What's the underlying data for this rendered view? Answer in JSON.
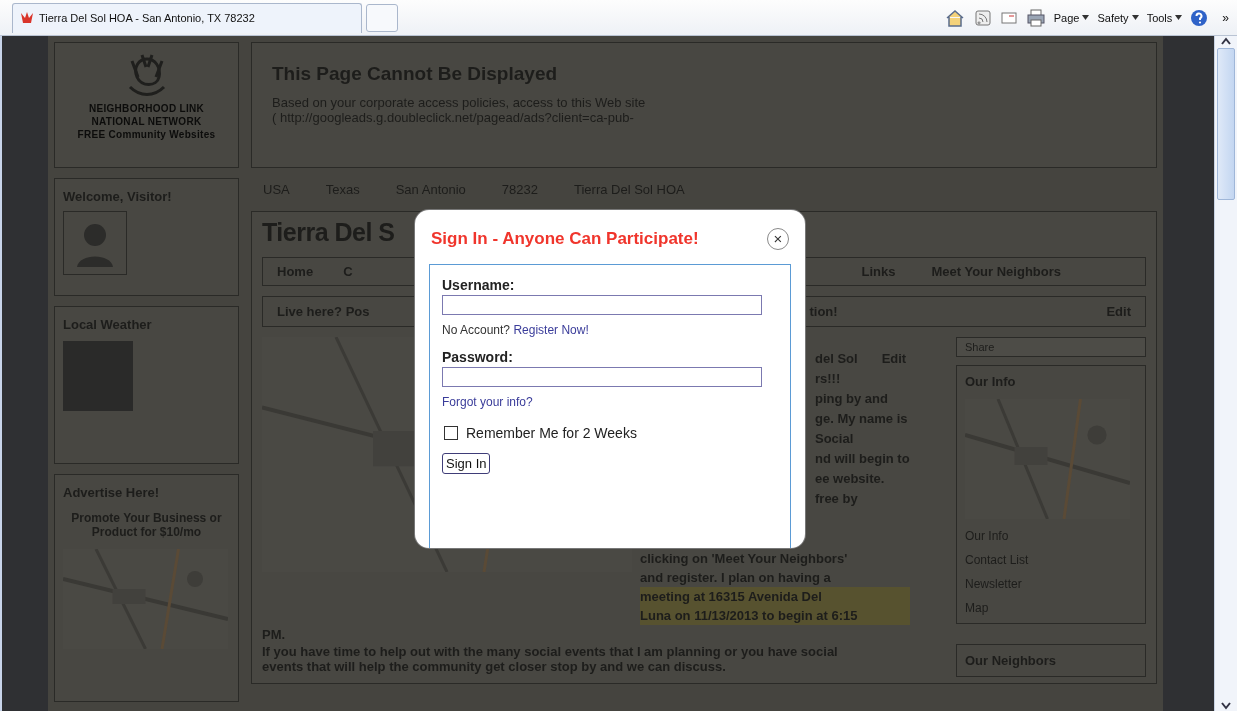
{
  "browser": {
    "tab_title": "Tierra Del Sol HOA - San Antonio, TX 78232",
    "menus": [
      "Page",
      "Safety",
      "Tools"
    ],
    "overflow": "»"
  },
  "page": {
    "logo_lines": [
      "NEIGHBORHOOD LINK",
      "NATIONAL NETWORK",
      "FREE Community Websites"
    ],
    "welcome_title": "Welcome, Visitor!",
    "weather_title": "Local Weather",
    "advertise": {
      "title": "Advertise Here!",
      "text": "Promote Your Business or Product for $10/mo"
    },
    "error": {
      "title": "This Page Cannot Be Displayed",
      "lines": [
        "Based on your corporate access policies, access to this Web site",
        "( http://googleads.g.doubleclick.net/pagead/ads?client=ca-pub-"
      ]
    },
    "breadcrumb": [
      "USA",
      "Texas",
      "San Antonio",
      "78232",
      "Tierra Del Sol HOA"
    ],
    "site_title": "Tierra Del S",
    "nav_left": [
      "Home",
      "C"
    ],
    "nav_right": [
      "Links",
      "Meet Your Neighbors"
    ],
    "banner": {
      "left": "Live here? Pos",
      "right": "tion!",
      "edit": "Edit"
    },
    "article": {
      "heading": "del Sol",
      "edit": "Edit",
      "side_lines": [
        "rs!!!",
        "ping by and",
        "ge. My name is",
        "Social",
        "nd will begin to",
        "ee website.",
        "free by"
      ],
      "lines": [
        {
          "text": "clicking on 'Meet Your Neighbors'",
          "highlighted": false
        },
        {
          "text": "and register. I plan on having a",
          "highlighted": false
        },
        {
          "text": "meeting at 16315 Avenida Del",
          "highlighted": true
        },
        {
          "text": "Luna on 11/13/2013 to begin at 6:15",
          "highlighted": true
        }
      ],
      "tail": "PM.",
      "paragraph": "If you have time to help out with the many social events that I am planning or you have social events that will help the community get closer stop by and we can discuss."
    },
    "share": "Share",
    "our_info": {
      "title": "Our Info",
      "links": [
        "Our Info",
        "Contact List",
        "Newsletter",
        "Map"
      ]
    },
    "neighbors_title": "Our Neighbors"
  },
  "modal": {
    "title": "Sign In - Anyone Can Participate!",
    "close": "×",
    "username_label": "Username:",
    "no_account": "No Account?",
    "register_link": "Register Now!",
    "password_label": "Password:",
    "forgot_link": "Forgot your info?",
    "remember": {
      "label": "Remember Me for 2 Weeks",
      "checked": false
    },
    "submit": "Sign In"
  }
}
